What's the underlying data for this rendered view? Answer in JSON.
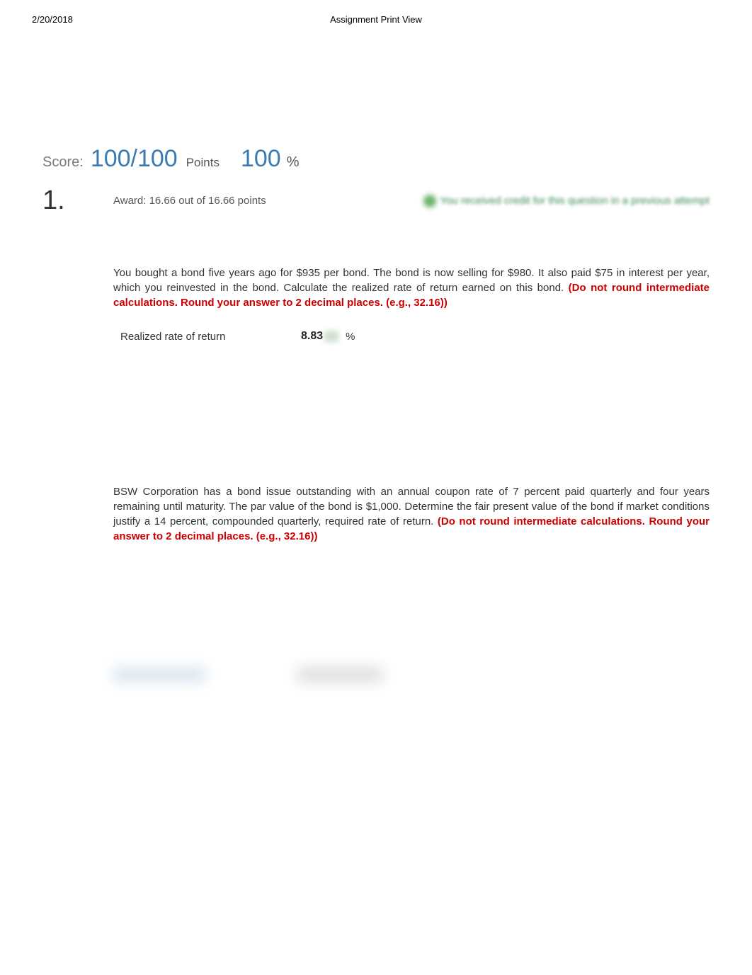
{
  "header": {
    "date": "2/20/2018",
    "title": "Assignment Print View"
  },
  "score": {
    "label": "Score:",
    "fraction": "100/100",
    "points_label": "Points",
    "percent_value": "100",
    "percent_sign": "%"
  },
  "question1": {
    "number": "1.",
    "award": "Award: 16.66 out of 16.66 points",
    "credit_notice": "You received credit for this question in a previous attempt",
    "body_part1": "You bought a bond five years ago for $935 per bond. The bond is now selling for $980. It also paid $75 in interest per year, which you reinvested in the bond. Calculate the realized rate of return earned on this bond. ",
    "instruction": "(Do not round intermediate calculations. Round your answer to 2 decimal places. (e.g., 32.16))",
    "answer_label": "Realized rate of return",
    "answer_value": "8.83",
    "answer_unit": "%"
  },
  "question2": {
    "body_part1": "BSW Corporation has a bond issue outstanding with an annual coupon rate of 7 percent paid quarterly and four years remaining until maturity. The par value of the bond is $1,000. Determine the fair present value of the bond if market conditions justify a 14 percent, compounded quarterly, required rate of return. ",
    "instruction": "(Do not round intermediate calculations. Round your answer to 2 decimal places. (e.g., 32.16))"
  }
}
